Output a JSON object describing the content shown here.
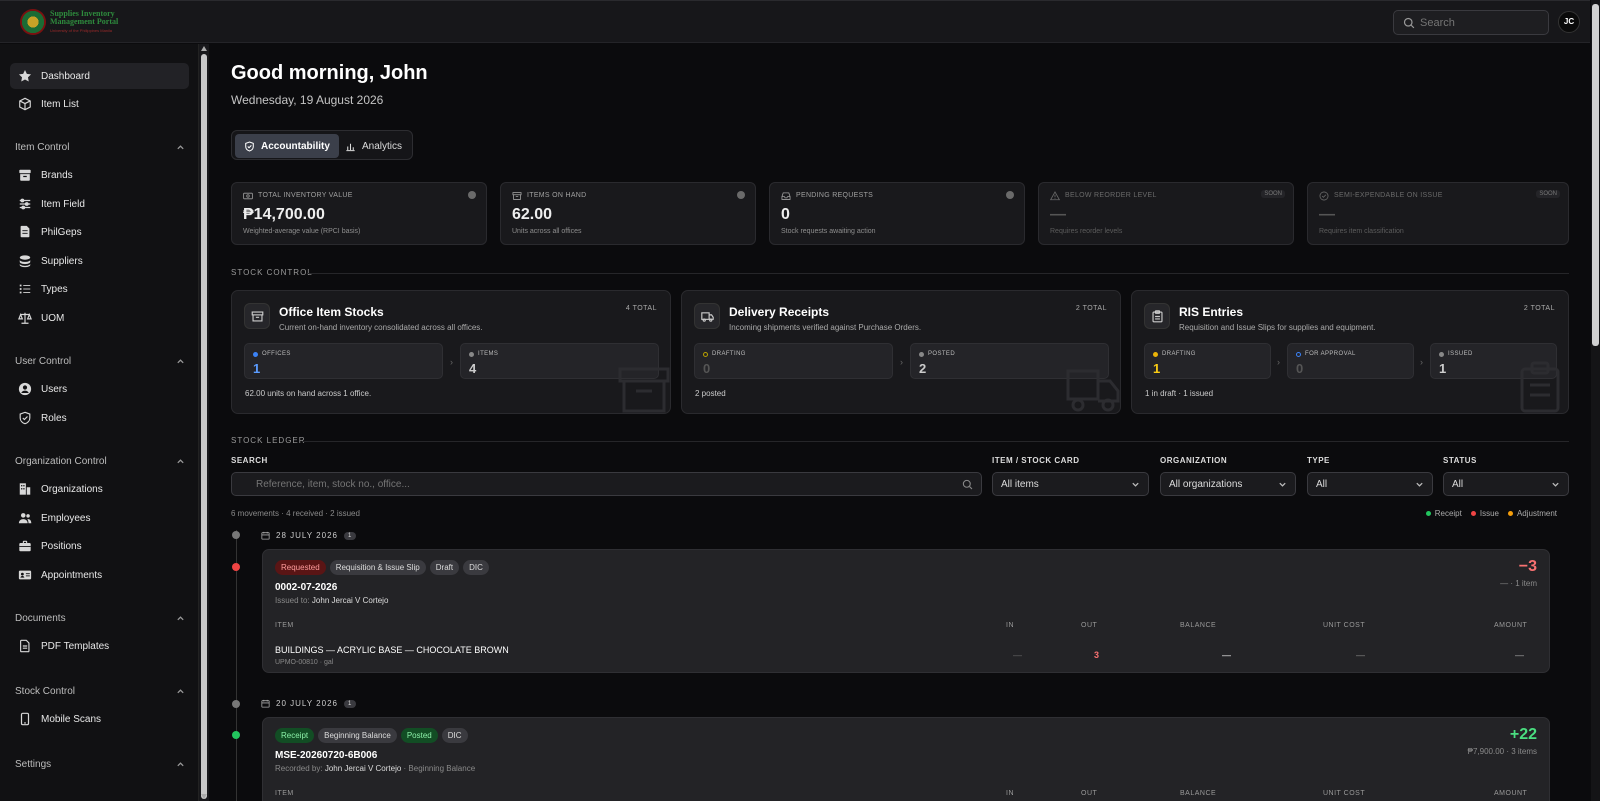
{
  "topbar": {
    "logo_line1": "Supplies Inventory",
    "logo_line2": "Management Portal",
    "logo_sub": "University of the Philippines Manila",
    "search_placeholder": "Search",
    "avatar_initials": "JC"
  },
  "sidebar": {
    "top_items": [
      {
        "label": "Dashboard",
        "icon": "star-icon",
        "active": true
      },
      {
        "label": "Item List",
        "icon": "cube-icon"
      }
    ],
    "sections": [
      {
        "title": "Item Control",
        "items": [
          {
            "label": "Brands",
            "icon": "archive-icon"
          },
          {
            "label": "Item Field",
            "icon": "sliders-icon"
          },
          {
            "label": "PhilGeps",
            "icon": "documents-icon"
          },
          {
            "label": "Suppliers",
            "icon": "stack-icon"
          },
          {
            "label": "Types",
            "icon": "list-icon"
          },
          {
            "label": "UOM",
            "icon": "scale-icon"
          }
        ]
      },
      {
        "title": "User Control",
        "items": [
          {
            "label": "Users",
            "icon": "user-circle-icon"
          },
          {
            "label": "Roles",
            "icon": "shield-icon"
          }
        ]
      },
      {
        "title": "Organization Control",
        "items": [
          {
            "label": "Organizations",
            "icon": "building-icon"
          },
          {
            "label": "Employees",
            "icon": "users-icon"
          },
          {
            "label": "Positions",
            "icon": "briefcase-icon"
          },
          {
            "label": "Appointments",
            "icon": "id-card-icon"
          }
        ]
      },
      {
        "title": "Documents",
        "items": [
          {
            "label": "PDF Templates",
            "icon": "file-icon"
          }
        ]
      },
      {
        "title": "Stock Control",
        "items": [
          {
            "label": "Mobile Scans",
            "icon": "phone-icon"
          }
        ]
      },
      {
        "title": "Settings",
        "items": []
      }
    ]
  },
  "main": {
    "greeting": "Good morning, John",
    "date": "Wednesday, 19 August 2026",
    "tabs": [
      {
        "label": "Accountability",
        "active": true
      },
      {
        "label": "Analytics",
        "active": false
      }
    ],
    "kpis": [
      {
        "label": "TOTAL INVENTORY VALUE",
        "value": "₱14,700.00",
        "sub": "Weighted-average value (RPCI basis)"
      },
      {
        "label": "ITEMS ON HAND",
        "value": "62.00",
        "sub": "Units across all offices"
      },
      {
        "label": "PENDING REQUESTS",
        "value": "0",
        "sub": "Stock requests awaiting action"
      },
      {
        "label": "BELOW REORDER LEVEL",
        "value": "—",
        "sub": "Requires reorder levels",
        "badge": "SOON"
      },
      {
        "label": "SEMI-EXPENDABLE ON ISSUE",
        "value": "—",
        "sub": "Requires item classification",
        "badge": "SOON"
      }
    ],
    "stock_control_label": "STOCK CONTROL",
    "cards": [
      {
        "title": "Office Item Stocks",
        "sub": "Current on-hand inventory consolidated across all offices.",
        "total": "4 TOTAL",
        "footer": "62.00 units on hand across 1 office.",
        "stats": [
          {
            "label": "OFFICES",
            "value": "1"
          },
          {
            "label": "ITEMS",
            "value": "4"
          }
        ]
      },
      {
        "title": "Delivery Receipts",
        "sub": "Incoming shipments verified against Purchase Orders.",
        "total": "2 TOTAL",
        "footer": "2 posted",
        "stats": [
          {
            "label": "DRAFTING",
            "value": "0"
          },
          {
            "label": "POSTED",
            "value": "2"
          }
        ]
      },
      {
        "title": "RIS Entries",
        "sub": "Requisition and Issue Slips for supplies and equipment.",
        "total": "2 TOTAL",
        "footer": "1 in draft · 1 issued",
        "stats": [
          {
            "label": "DRAFTING",
            "value": "1"
          },
          {
            "label": "FOR APPROVAL",
            "value": "0"
          },
          {
            "label": "ISSUED",
            "value": "1"
          }
        ]
      }
    ],
    "ledger_label": "STOCK LEDGER",
    "filters": {
      "search_label": "SEARCH",
      "search_placeholder": "Reference, item, stock no., office...",
      "item_label": "ITEM / STOCK CARD",
      "item_value": "All items",
      "org_label": "ORGANIZATION",
      "org_value": "All organizations",
      "type_label": "TYPE",
      "type_value": "All",
      "status_label": "STATUS",
      "status_value": "All"
    },
    "meta": "6 movements · 4 received · 2 issued",
    "legend": [
      "Receipt",
      "Issue",
      "Adjustment"
    ],
    "colors": {
      "receipt": "#22c55e",
      "issue": "#ef4444",
      "adjustment": "#f59e0b",
      "accent_blue": "#3b82f6"
    },
    "groups": [
      {
        "date": "28 JULY 2026",
        "count": "1",
        "entry": {
          "tags": [
            "Requested",
            "Requisition & Issue Slip",
            "Draft",
            "DIC"
          ],
          "ref": "0002-07-2026",
          "by_label": "Issued to:",
          "by_name": "John Jercai V Cortejo",
          "by_extra": "",
          "amount": "−3",
          "amount_sub": "— · 1 item",
          "headers": [
            "ITEM",
            "IN",
            "OUT",
            "BALANCE",
            "UNIT COST",
            "AMOUNT"
          ],
          "row": {
            "item": "BUILDINGS — ACRYLIC BASE — CHOCOLATE BROWN",
            "code": "UPMO-00810 · gal",
            "in": "—",
            "out": "3",
            "balance": "—",
            "unit_cost": "—",
            "amount": "—"
          }
        }
      },
      {
        "date": "20 JULY 2026",
        "count": "1",
        "entry": {
          "tags": [
            "Receipt",
            "Beginning Balance",
            "Posted",
            "DIC"
          ],
          "ref": "MSE-20260720-6B006",
          "by_label": "Recorded by:",
          "by_name": "John Jercai V Cortejo",
          "by_extra": "· Beginning Balance",
          "amount": "+22",
          "amount_sub": "₱7,900.00 · 3 items",
          "headers": [
            "ITEM",
            "IN",
            "OUT",
            "BALANCE",
            "UNIT COST",
            "AMOUNT"
          ]
        }
      }
    ]
  }
}
